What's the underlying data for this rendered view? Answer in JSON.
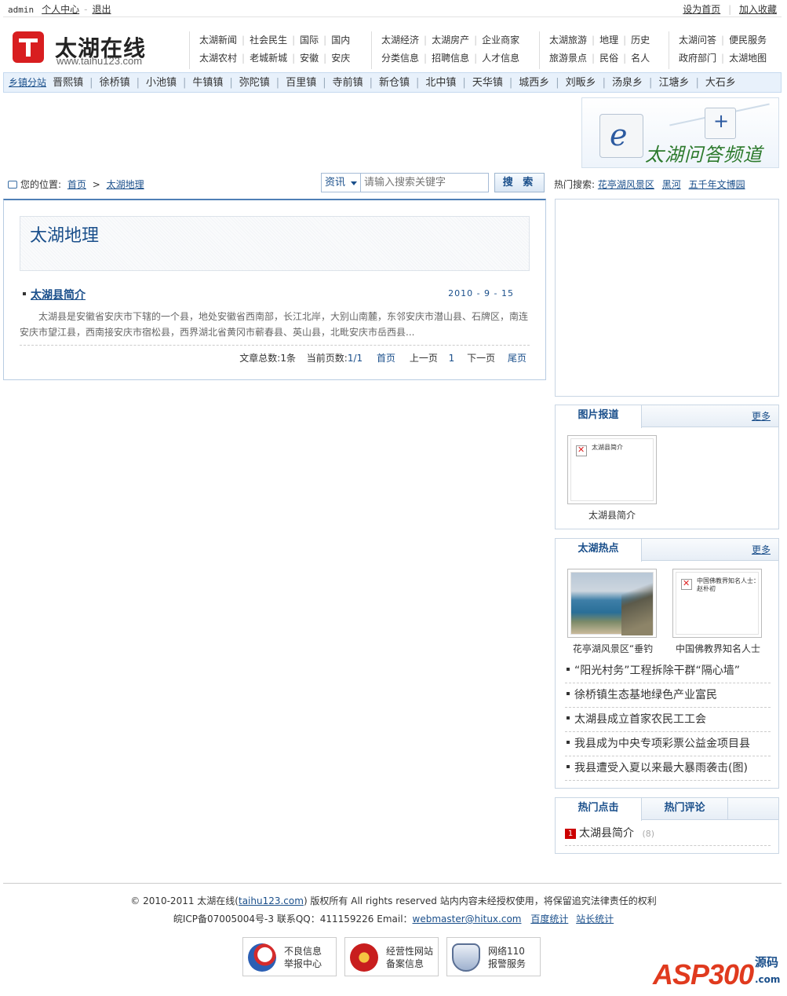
{
  "topbar": {
    "user": "admin",
    "user_center": "个人中心",
    "separator": "-",
    "logout": "退出",
    "set_home": "设为首页",
    "add_fav": "加入收藏"
  },
  "logo": {
    "title": "太湖在线",
    "url": "www.taihu123.com"
  },
  "nav": {
    "g1_row1": [
      "太湖新闻",
      "社会民生",
      "国际",
      "国内"
    ],
    "g1_row2": [
      "太湖农村",
      "老城新城",
      "安徽",
      "安庆"
    ],
    "g2_row1": [
      "太湖经济",
      "太湖房产",
      "企业商家"
    ],
    "g2_row2": [
      "分类信息",
      "招聘信息",
      "人才信息"
    ],
    "g3_row1": [
      "太湖旅游",
      "地理",
      "历史"
    ],
    "g3_row2": [
      "旅游景点",
      "民俗",
      "名人"
    ],
    "g4_row1": [
      "太湖问答",
      "便民服务"
    ],
    "g4_row2": [
      "政府部门",
      "太湖地图"
    ]
  },
  "townbar": {
    "lead": "乡镇分站",
    "towns": [
      "晋熙镇",
      "徐桥镇",
      "小池镇",
      "牛镇镇",
      "弥陀镇",
      "百里镇",
      "寺前镇",
      "新仓镇",
      "北中镇",
      "天华镇",
      "城西乡",
      "刘畈乡",
      "汤泉乡",
      "江塘乡",
      "大石乡"
    ]
  },
  "banner": {
    "letter": "e",
    "plus": "+",
    "title": "太湖问答频道"
  },
  "location": {
    "label": "您的位置:",
    "home": "首页",
    "arrow": ">",
    "current": "太湖地理"
  },
  "search": {
    "category": "资讯",
    "placeholder": "请输入搜索关键字",
    "button": "搜 索"
  },
  "hot_search": {
    "label": "热门搜索:",
    "items": [
      "花亭湖风景区",
      "黑河",
      "五千年文博园"
    ]
  },
  "main": {
    "category_title": "太湖地理",
    "article": {
      "title": "太湖县简介",
      "date": "2010 - 9 - 15",
      "desc": "太湖县是安徽省安庆市下辖的一个县，地处安徽省西南部，长江北岸，大别山南麓，东邻安庆市潜山县、石牌区，南连安庆市望江县，西南接安庆市宿松县，西界湖北省黄冈市蕲春县、英山县，北毗安庆市岳西县..."
    },
    "pager": {
      "total_label": "文章总数:",
      "total": "1条",
      "page_label": "当前页数:",
      "page": "1/1",
      "first": "首页",
      "prev": "上一页",
      "num": "1",
      "next": "下一页",
      "last": "尾页"
    }
  },
  "photo_news": {
    "title": "图片报道",
    "more": "更多",
    "thumb_alt": "太湖县简介",
    "caption": "太湖县简介"
  },
  "hot_spots": {
    "title": "太湖热点",
    "more": "更多",
    "thumb2_alt": "中国佛教界知名人士：赵朴初",
    "cap1": "花亭湖风景区“垂钓",
    "cap2": "中国佛教界知名人士",
    "items": [
      "“阳光村务”工程拆除干群“隔心墙”",
      "徐桥镇生态基地绿色产业富民",
      "太湖县成立首家农民工工会",
      "我县成为中央专项彩票公益金项目县",
      "我县遭受入夏以来最大暴雨袭击(图)"
    ]
  },
  "hot_click": {
    "tab1": "热门点击",
    "tab2": "热门评论",
    "rank": "1",
    "item": "太湖县简介",
    "count": "(8)"
  },
  "footer": {
    "copy_pre": "© 2010-2011 太湖在线(",
    "copy_link": "taihu123.com",
    "copy_post": ") 版权所有  All rights reserved  站内内容未经授权使用，将保留追究法律责任的权利",
    "icp": "皖ICP备07005004号-3  联系QQ：411159226  Email：",
    "email": "webmaster@hitux.com",
    "baidu": "百度统计",
    "cnzz": "站长统计",
    "badge1_l1": "不良信息",
    "badge1_l2": "举报中心",
    "badge2_l1": "经营性网站",
    "badge2_l2": "备案信息",
    "badge3_l1": "网络110",
    "badge3_l2": "报警服务"
  },
  "watermark": {
    "brand": "ASP300",
    "cn": "源码",
    "com": ".com"
  },
  "colors": {
    "link": "#1a4f8b",
    "brand_red": "#d81e20",
    "border": "#c9d6e4"
  }
}
